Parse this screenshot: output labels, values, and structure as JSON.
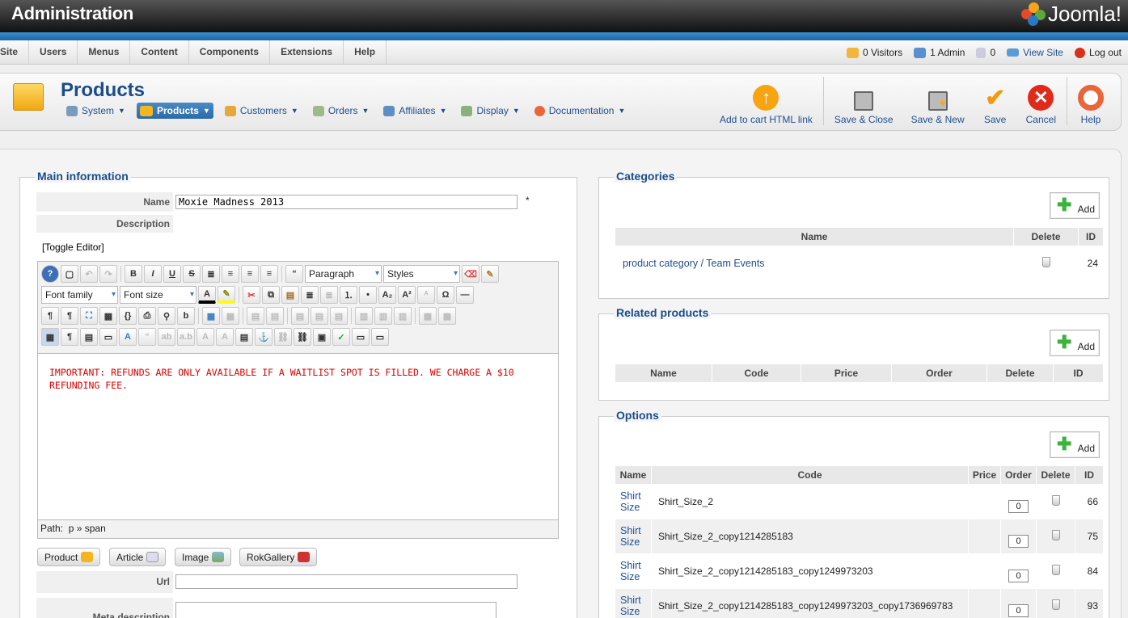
{
  "app": {
    "title": "Administration",
    "brand": "Joomla!"
  },
  "menu": [
    "Site",
    "Users",
    "Menus",
    "Content",
    "Components",
    "Extensions",
    "Help"
  ],
  "status": {
    "visitors": "0 Visitors",
    "admins": "1 Admin",
    "messages": "0",
    "view_site": "View Site",
    "logout": "Log out"
  },
  "page": {
    "title": "Products"
  },
  "submenu": [
    {
      "label": "System",
      "icon": "wrench-icon"
    },
    {
      "label": "Products",
      "icon": "box-icon",
      "active": true
    },
    {
      "label": "Customers",
      "icon": "people-icon"
    },
    {
      "label": "Orders",
      "icon": "order-icon"
    },
    {
      "label": "Affiliates",
      "icon": "affiliate-icon"
    },
    {
      "label": "Display",
      "icon": "display-icon"
    },
    {
      "label": "Documentation",
      "icon": "lifebuoy-icon"
    }
  ],
  "toolbar": {
    "add_to_cart": "Add to cart HTML link",
    "save_close": "Save & Close",
    "save_new": "Save & New",
    "save": "Save",
    "cancel": "Cancel",
    "help": "Help"
  },
  "main": {
    "legend": "Main information",
    "name_label": "Name",
    "name_value": "Moxie Madness 2013",
    "required_mark": "*",
    "description_label": "Description",
    "toggle_editor": "[Toggle Editor]",
    "editor": {
      "format_select": "Paragraph",
      "styles_select": "Styles",
      "font_family": "Font family",
      "font_size": "Font size",
      "content": "IMPORTANT:  REFUNDS ARE ONLY AVAILABLE IF A WAITLIST SPOT IS FILLED.  WE CHARGE A $10 REFUNDING FEE.",
      "path_label": "Path:",
      "path_value": "p » span"
    },
    "buttons": [
      "Product",
      "Article",
      "Image",
      "RokGallery"
    ],
    "url_label": "Url",
    "meta_label": "Meta description"
  },
  "categories": {
    "legend": "Categories",
    "add": "Add",
    "columns": [
      "Name",
      "Delete",
      "ID"
    ],
    "rows": [
      {
        "name": "product category / Team Events",
        "id": "24"
      }
    ]
  },
  "related": {
    "legend": "Related products",
    "add": "Add",
    "columns": [
      "Name",
      "Code",
      "Price",
      "Order",
      "Delete",
      "ID"
    ]
  },
  "options": {
    "legend": "Options",
    "add": "Add",
    "columns": [
      "Name",
      "Code",
      "Price",
      "Order",
      "Delete",
      "ID"
    ],
    "rows": [
      {
        "name": "Shirt Size",
        "code": "Shirt_Size_2",
        "order": "0",
        "id": "66"
      },
      {
        "name": "Shirt Size",
        "code": "Shirt_Size_2_copy1214285183",
        "order": "0",
        "id": "75"
      },
      {
        "name": "Shirt Size",
        "code": "Shirt_Size_2_copy1214285183_copy1249973203",
        "order": "0",
        "id": "84"
      },
      {
        "name": "Shirt Size",
        "code": "Shirt_Size_2_copy1214285183_copy1249973203_copy1736969783",
        "order": "0",
        "id": "93"
      }
    ]
  }
}
